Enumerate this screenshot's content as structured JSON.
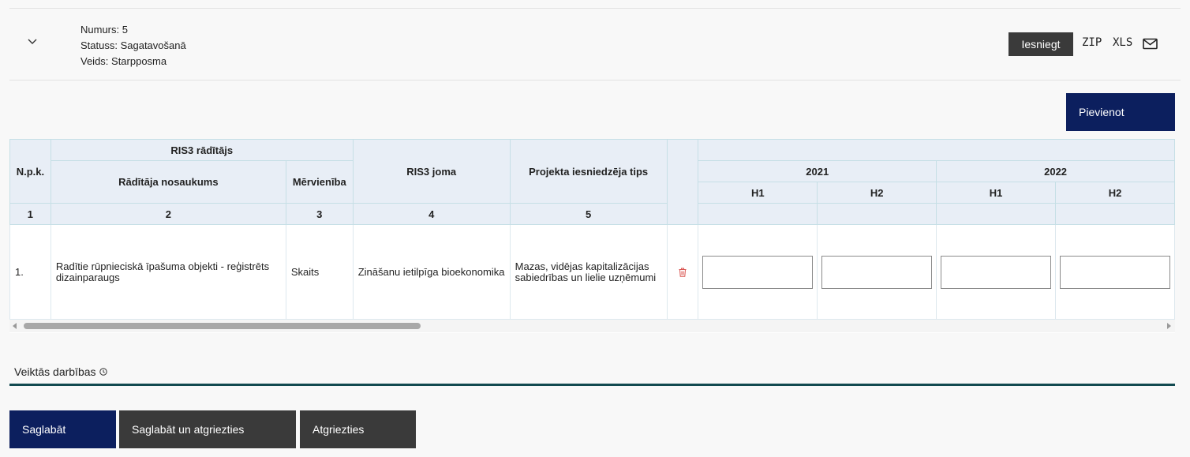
{
  "record": {
    "number": "Numurs: 5",
    "status": "Statuss: Sagatavošanā",
    "type": "Veids: Starpposma"
  },
  "actions": {
    "submit": "Iesniegt",
    "zip": "ZIP",
    "xls": "XLS",
    "mail_icon": "envelope-icon",
    "expand_icon": "chevron-down-icon"
  },
  "add_button": "Pievienot",
  "table": {
    "headers": {
      "npk": "N.p.k.",
      "ris3_indicator": "RIS3 rādītājs",
      "indicator_name": "Rādītāja nosaukums",
      "unit": "Mērvienība",
      "ris3_area": "RIS3 joma",
      "applicant_type": "Projekta iesniedzēja tips",
      "year1": "2021",
      "year2": "2022",
      "h1": "H1",
      "h2": "H2"
    },
    "column_numbers": [
      "1",
      "2",
      "3",
      "4",
      "5"
    ],
    "rows": [
      {
        "npk": "1.",
        "indicator_name": "Radītie rūpnieciskā īpašuma objekti - reģistrēts dizainparaugs",
        "unit": "Skaits",
        "ris3_area": "Zināšanu ietilpīga bioekonomika",
        "applicant_type": "Mazas, vidējas kapitalizācijas sabiedrības un lielie uzņēmumi",
        "values": [
          "",
          "",
          "",
          ""
        ]
      }
    ]
  },
  "activity": {
    "label": "Veiktās darbības",
    "icon": "clock-icon"
  },
  "footer": {
    "save": "Saglabāt",
    "save_and_return": "Saglabāt un atgriezties",
    "return": "Atgriezties"
  },
  "colors": {
    "primary": "#0c1f5e",
    "dark_button": "#3a3a3a",
    "header_bg": "#e8eef6",
    "accent_line": "#124a50",
    "delete": "#d9534f"
  }
}
